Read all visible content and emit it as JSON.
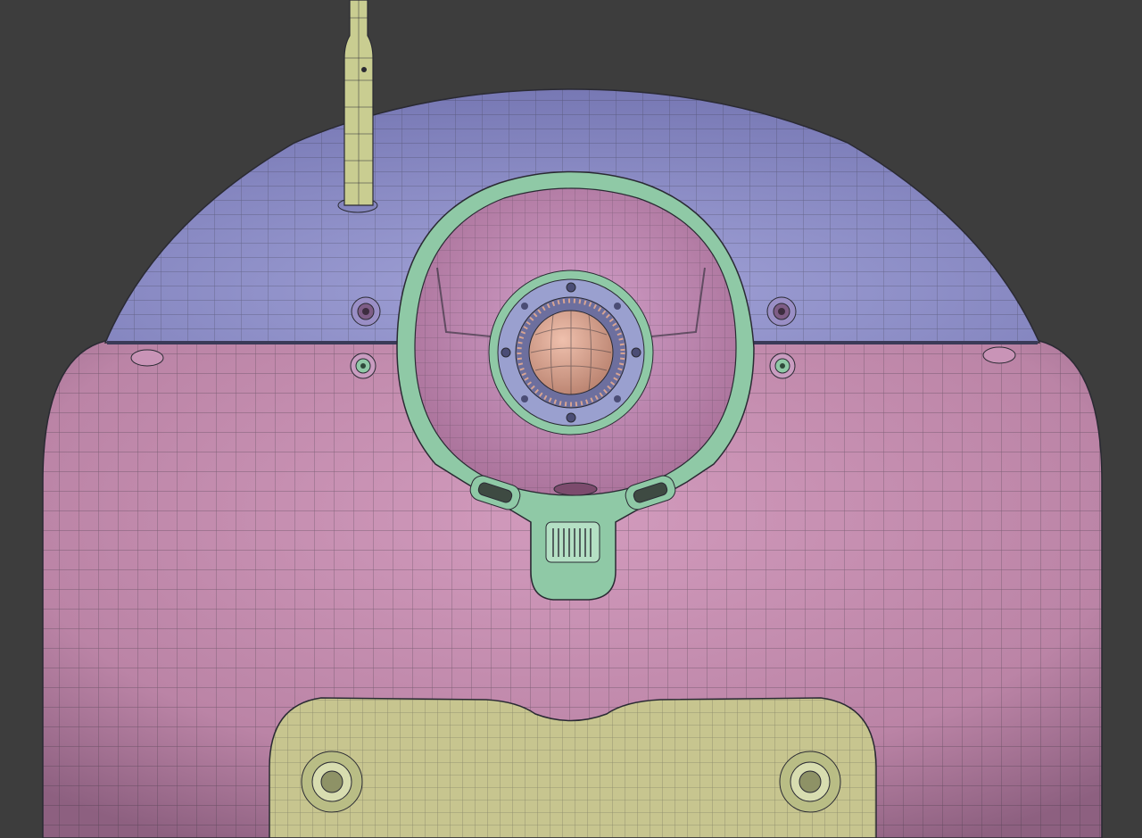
{
  "scene": {
    "subject": "robot-head-wireframe-render",
    "colors": {
      "background": "#3d3d3d",
      "dome_shell": "#8e8fc9",
      "body_shell": "#c088ab",
      "eye_socket": "#c98fbf",
      "eye_ring": "#8fc9a6",
      "lens_housing": "#9aa0cf",
      "lens_core": "#d7a493",
      "antenna": "#c9cd91",
      "chest_panel": "#c7c58f",
      "wire": "#2a2a33"
    }
  }
}
